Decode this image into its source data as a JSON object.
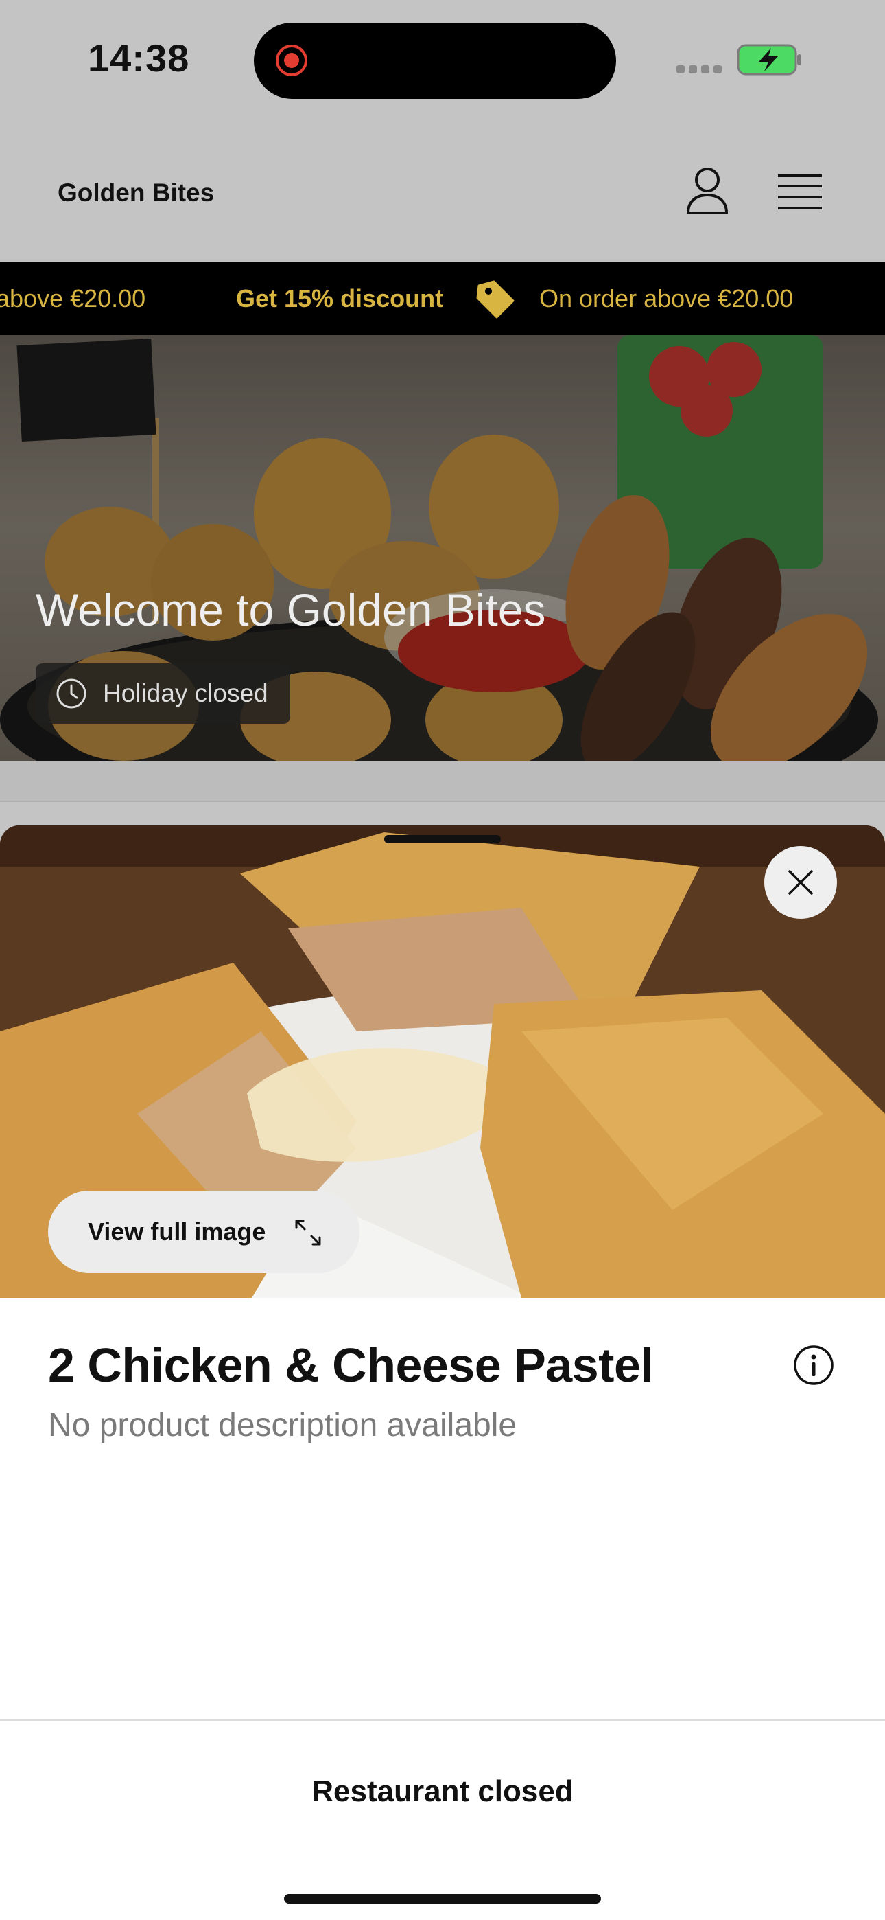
{
  "status_bar": {
    "time": "14:38"
  },
  "header": {
    "brand": "Golden Bites",
    "user_icon": "user-icon",
    "menu_icon": "hamburger-menu-icon"
  },
  "promo": {
    "prev_text": "above €20.00",
    "headline": "Get 15% discount",
    "detail": "On order above €20.00",
    "icon": "price-tag-icon",
    "accent_color": "#d8b441"
  },
  "hero": {
    "title": "Welcome to Golden Bites",
    "status_label": "Holiday closed",
    "status_icon": "clock-icon"
  },
  "product_sheet": {
    "view_full_label": "View full image",
    "title": "2 Chicken & Cheese Pastel",
    "description": "No product description available",
    "close_icon": "close-icon",
    "info_icon": "info-icon",
    "expand_icon": "expand-icon"
  },
  "footer": {
    "status": "Restaurant closed"
  }
}
